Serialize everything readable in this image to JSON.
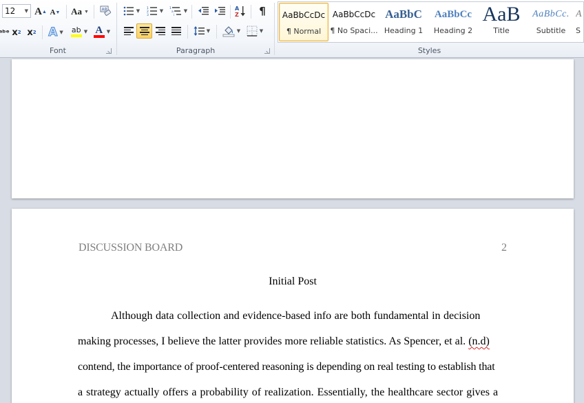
{
  "ribbon": {
    "font_group": {
      "label": "Font",
      "font_size": "12",
      "grow_font": "A",
      "shrink_font": "A",
      "change_case": "Aa",
      "subscript": "x",
      "superscript": "x",
      "text_effects": "A",
      "highlight": "ab",
      "font_color": "A",
      "highlight_color": "#ffff00",
      "font_color_value": "#ff0000"
    },
    "paragraph_group": {
      "label": "Paragraph",
      "sort": "A↓",
      "show_marks": "¶",
      "active_alignment": "center"
    },
    "styles_group": {
      "label": "Styles",
      "items": [
        {
          "preview": "AaBbCcDc",
          "name": "¶ Normal",
          "selected": true
        },
        {
          "preview": "AaBbCcDc",
          "name": "¶ No Spaci..."
        },
        {
          "preview": "AaBbC",
          "name": "Heading 1"
        },
        {
          "preview": "AaBbCc",
          "name": "Heading 2"
        },
        {
          "preview": "AaB",
          "name": "Title"
        },
        {
          "preview": "AaBbCc.",
          "name": "Subtitle"
        },
        {
          "preview": "A",
          "name": "S"
        }
      ]
    }
  },
  "document": {
    "page2": {
      "header_left": "DISCUSSION BOARD",
      "page_number": "2",
      "title": "Initial Post",
      "lines": [
        "Although data collection and evidence-based info are both fundamental in decision",
        "making processes, I believe the latter provides more reliable statistics. As Spencer, et al.",
        "contend, the importance of proof-centered reasoning is depending on real testing to establish that",
        "a strategy actually offers a probability of realization. Essentially, the healthcare sector gives a"
      ],
      "citation_misspelled": "(n.d)"
    }
  }
}
